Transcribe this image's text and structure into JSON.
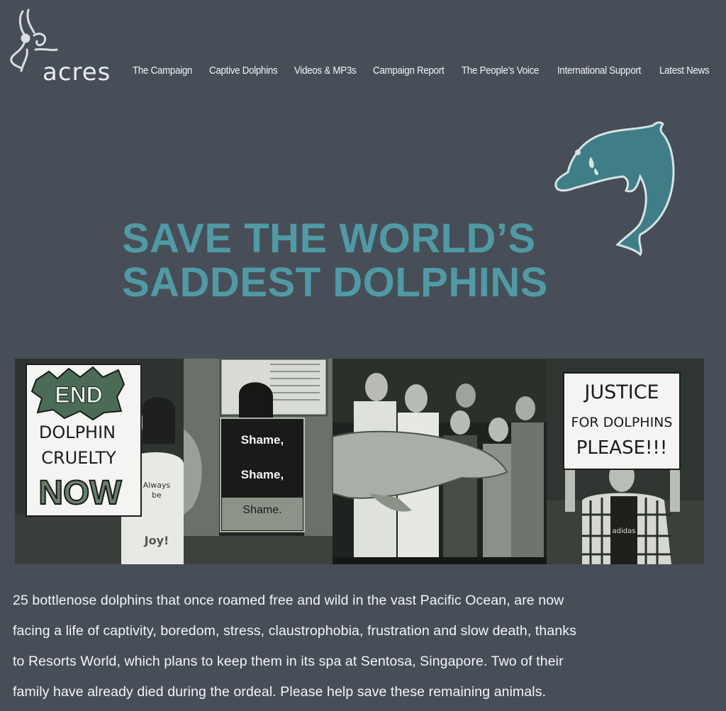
{
  "brand": {
    "logo_text": "acres"
  },
  "nav": {
    "items": [
      {
        "label": "The Campaign"
      },
      {
        "label": "Captive Dolphins"
      },
      {
        "label": "Videos & MP3s"
      },
      {
        "label": "Campaign Report"
      },
      {
        "label": "The People’s Voice"
      },
      {
        "label": "International Support"
      },
      {
        "label": "Latest News"
      }
    ]
  },
  "hero": {
    "title_line1": "SAVE THE WORLD’S",
    "title_line2": "SADDEST DOLPHINS",
    "accent_color": "#4f9aa4",
    "icon": "crying-dolphin-icon"
  },
  "photos": {
    "sign1": [
      "END",
      "DOLPHIN",
      "CRUELTY",
      "NOW"
    ],
    "shirt_text": [
      "Always",
      "be",
      "Joy!"
    ],
    "sign2": [
      "Shame,",
      "Shame,",
      "Shame."
    ],
    "sign3": [
      "JUSTICE",
      "FOR DOLPHINS",
      "PLEASE!!!"
    ],
    "shirt_brand": "adidas"
  },
  "body": {
    "lines": [
      "25 bottlenose dolphins that once roamed free and wild in the vast Pacific Ocean, are now",
      "facing a life of captivity, boredom, stress, claustrophobia, frustration and slow death, thanks",
      "to Resorts World, which plans to keep them in its spa at Sentosa, Singapore. Two of their",
      "family have already died during the ordeal. Please help save these remaining animals."
    ]
  }
}
